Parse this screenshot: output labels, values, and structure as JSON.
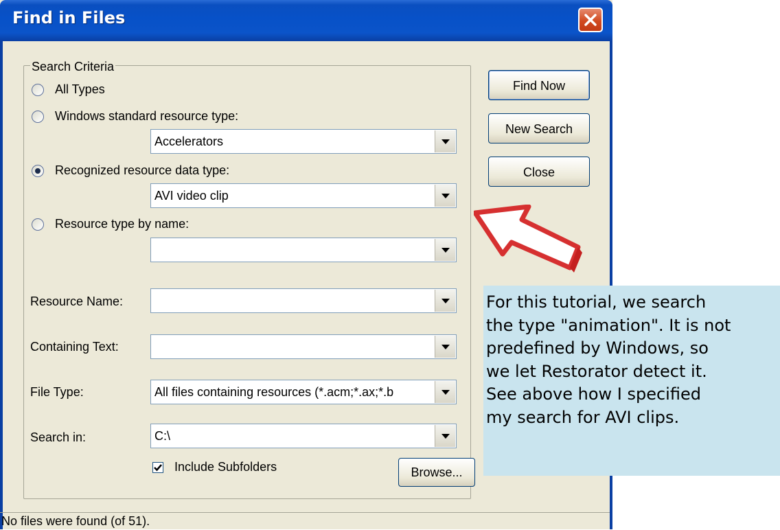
{
  "window": {
    "title": "Find in Files",
    "close_icon": "close-icon"
  },
  "search_criteria": {
    "label": "Search Criteria",
    "options": {
      "all_types": "All Types",
      "windows_standard": "Windows standard resource type:",
      "recognized": "Recognized resource data type:",
      "by_name": "Resource type by name:"
    },
    "selected_option": "recognized",
    "windows_standard_value": "Accelerators",
    "recognized_value": "AVI video clip",
    "by_name_value": ""
  },
  "fields": {
    "resource_name_label": "Resource Name:",
    "resource_name_value": "",
    "containing_text_label": "Containing Text:",
    "containing_text_value": "",
    "file_type_label": "File Type:",
    "file_type_value": "All files containing resources (*.acm;*.ax;*.b",
    "search_in_label": "Search in:",
    "search_in_value": "C:\\"
  },
  "include_subfolders": {
    "label": "Include Subfolders",
    "checked": true
  },
  "buttons": {
    "find_now": "Find Now",
    "new_search": "New Search",
    "close": "Close",
    "browse": "Browse..."
  },
  "status": "No files were found (of 51).",
  "callout": {
    "lines": [
      "For this tutorial, we search",
      "the type \"animation\". It is not",
      "predefined by Windows, so",
      "we let Restorator detect it.",
      "See above how I specified",
      "my search for AVI clips."
    ],
    "background": "#c9e4ee",
    "arrow_color": "#d63030"
  },
  "colors": {
    "title_bar": "#0751c8",
    "dialog_bg": "#ece9d8",
    "close_button": "#d14a20"
  }
}
